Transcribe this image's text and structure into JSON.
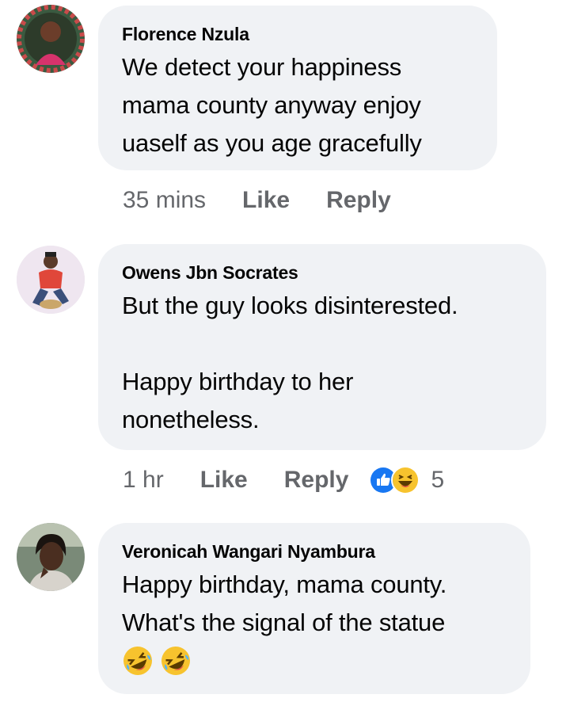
{
  "comments": [
    {
      "author": "Florence Nzula",
      "lines": [
        "We detect your happiness",
        "mama county anyway enjoy",
        "uaself as you age gracefully"
      ],
      "time": "35 mins",
      "like_label": "Like",
      "reply_label": "Reply"
    },
    {
      "author": "Owens Jbn Socrates",
      "lines": [
        "But the guy looks disinterested.",
        "",
        "Happy birthday to her",
        "nonetheless."
      ],
      "time": "1 hr",
      "like_label": "Like",
      "reply_label": "Reply",
      "reactions": {
        "icons": [
          "like-reaction",
          "haha-reaction"
        ],
        "count": "5"
      }
    },
    {
      "author": "Veronicah Wangari Nyambura",
      "lines": [
        "Happy birthday, mama county.",
        "What's the signal of the statue"
      ],
      "emojis": [
        "rolling-on-floor-laughing",
        "rolling-on-floor-laughing"
      ]
    }
  ],
  "colors": {
    "bubble": "#f0f2f5",
    "meta_text": "#65676b",
    "like_blue": "#1877f2",
    "haha_yellow": "#f7c32e"
  }
}
